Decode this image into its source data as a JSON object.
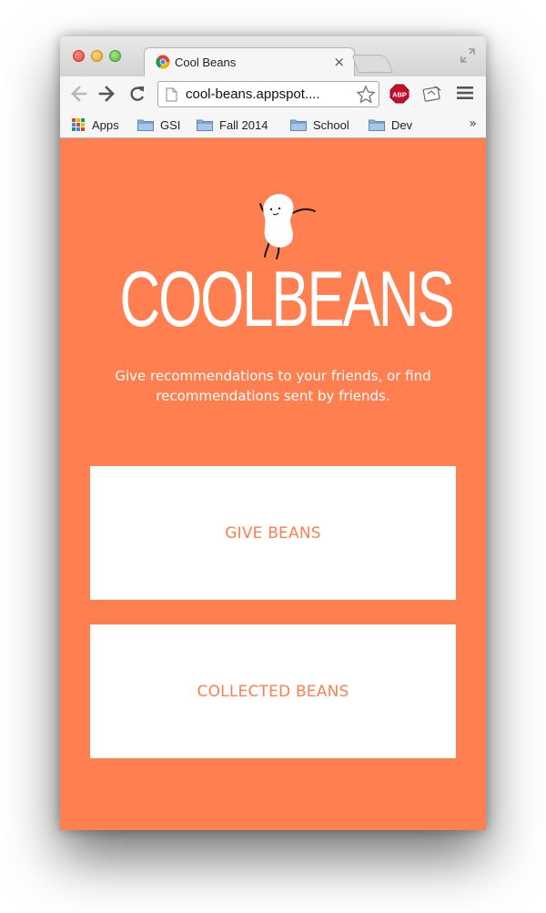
{
  "browser": {
    "tab": {
      "title": "Cool Beans",
      "close": "×",
      "favicon": "chrome-app-icon"
    },
    "omnibox": {
      "url": "cool-beans.appspot...."
    },
    "bookmarks": [
      {
        "label": "Apps",
        "icon": "apps-grid-icon"
      },
      {
        "label": "GSI",
        "icon": "folder-icon"
      },
      {
        "label": "Fall 2014",
        "icon": "folder-icon"
      },
      {
        "label": "School",
        "icon": "folder-icon"
      },
      {
        "label": "Dev",
        "icon": "folder-icon"
      }
    ],
    "bookmarks_more": "»",
    "extensions": {
      "abp_label": "ABP"
    }
  },
  "page": {
    "brand_color": "#ff7f50",
    "logo": "COOLBEANS",
    "tagline": "Give recommendations to your friends, or find recommendations sent by friends.",
    "actions": [
      {
        "label": "GIVE BEANS"
      },
      {
        "label": "COLLECTED BEANS"
      }
    ]
  }
}
